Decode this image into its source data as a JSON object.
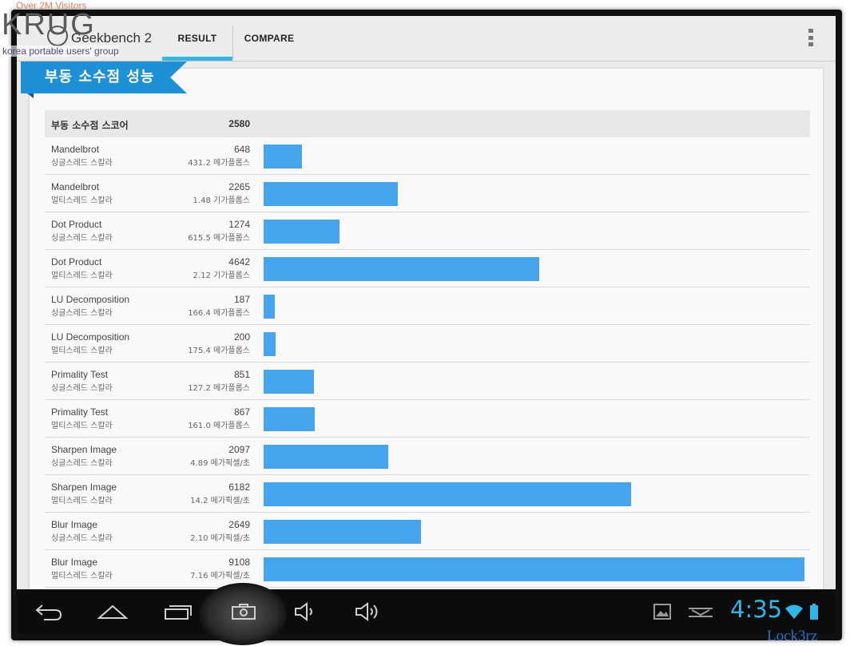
{
  "watermark": {
    "visitors": "Over 2M Visitors",
    "logo": "KRUG",
    "tagline": "korea portable users' group"
  },
  "app": {
    "title": "Geekbench 2"
  },
  "tabs": [
    {
      "label": "RESULT"
    },
    {
      "label": "COMPARE"
    }
  ],
  "section_title": "부동 소수점 성능",
  "score": {
    "label": "부동 소수점 스코어",
    "value": "2580"
  },
  "max_score": 9108,
  "rows": [
    {
      "name": "Mandelbrot",
      "mode": "싱글스레드 스칼라",
      "score": 648,
      "score_text": "648",
      "rate": "431.2 메가플롭스"
    },
    {
      "name": "Mandelbrot",
      "mode": "멀티스레드 스칼라",
      "score": 2265,
      "score_text": "2265",
      "rate": "1.48 기가플롭스"
    },
    {
      "name": "Dot Product",
      "mode": "싱글스레드 스칼라",
      "score": 1274,
      "score_text": "1274",
      "rate": "615.5 메가플롭스"
    },
    {
      "name": "Dot Product",
      "mode": "멀티스레드 스칼라",
      "score": 4642,
      "score_text": "4642",
      "rate": "2.12 기가플롭스"
    },
    {
      "name": "LU Decomposition",
      "mode": "싱글스레드 스칼라",
      "score": 187,
      "score_text": "187",
      "rate": "166.4 메가플롭스"
    },
    {
      "name": "LU Decomposition",
      "mode": "멀티스레드 스칼라",
      "score": 200,
      "score_text": "200",
      "rate": "175.4 메가플롭스"
    },
    {
      "name": "Primality Test",
      "mode": "싱글스레드 스칼라",
      "score": 851,
      "score_text": "851",
      "rate": "127.2 메가플롭스"
    },
    {
      "name": "Primality Test",
      "mode": "멀티스레드 스칼라",
      "score": 867,
      "score_text": "867",
      "rate": "161.0 메가플롭스"
    },
    {
      "name": "Sharpen Image",
      "mode": "싱글스레드 스칼라",
      "score": 2097,
      "score_text": "2097",
      "rate": "4.89 메가픽셀/초"
    },
    {
      "name": "Sharpen Image",
      "mode": "멀티스레드 스칼라",
      "score": 6182,
      "score_text": "6182",
      "rate": "14.2 메가픽셀/초"
    },
    {
      "name": "Blur Image",
      "mode": "싱글스레드 스칼라",
      "score": 2649,
      "score_text": "2649",
      "rate": "2.10 메가픽셀/초"
    },
    {
      "name": "Blur Image",
      "mode": "멀티스레드 스칼라",
      "score": 9108,
      "score_text": "9108",
      "rate": "7.16 메가픽셀/초"
    }
  ],
  "status": {
    "time": "4:35"
  },
  "colors": {
    "accent": "#33b5e5",
    "bar": "#45a4ec",
    "ribbon": "#1f8fd6"
  },
  "icons": [
    "back-icon",
    "home-icon",
    "recent-apps-icon",
    "screenshot-camera-icon",
    "volume-down-icon",
    "volume-up-icon",
    "gallery-notification-icon",
    "download-notification-icon",
    "wifi-icon",
    "battery-icon"
  ],
  "signature": "Lock3rz"
}
